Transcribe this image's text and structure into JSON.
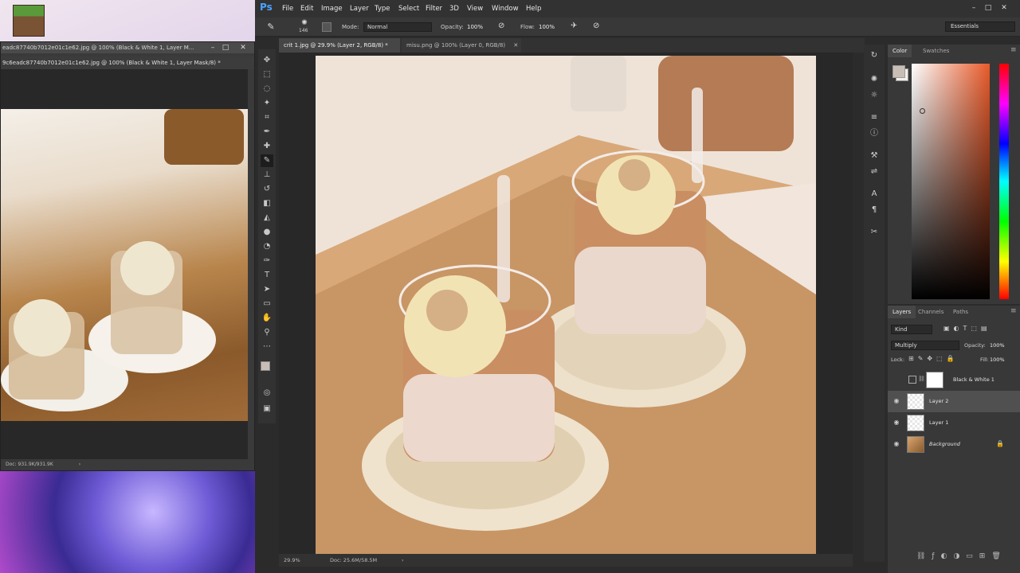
{
  "desktop": {
    "icon_name": "minecraft-icon"
  },
  "float_window": {
    "title": "eadc87740b7012e01c1e62.jpg @ 100% (Black & White 1, Layer M...",
    "tab": "9c6eadc87740b7012e01c1e62.jpg @ 100% (Black & White 1, Layer Mask/8) *",
    "status": "Doc: 931.9K/931.9K"
  },
  "ps": {
    "logo": "Ps",
    "menu": [
      "File",
      "Edit",
      "Image",
      "Layer",
      "Type",
      "Select",
      "Filter",
      "3D",
      "View",
      "Window",
      "Help"
    ],
    "options": {
      "brush_size": "146",
      "mode_label": "Mode:",
      "mode_value": "Normal",
      "opacity_label": "Opacity:",
      "opacity_value": "100%",
      "flow_label": "Flow:",
      "flow_value": "100%",
      "workspace": "Essentials"
    },
    "doc_tabs": [
      {
        "label": "crit 1.jpg @ 29.9% (Layer 2, RGB/8) *",
        "active": true
      },
      {
        "label": "misu.png @ 100% (Layer 0, RGB/8)",
        "active": false
      }
    ],
    "status": {
      "zoom": "29.9%",
      "doc": "Doc: 25.6M/58.5M"
    },
    "color_panel": {
      "tabs": [
        "Color",
        "Swatches"
      ],
      "foreground": "#c9beb6",
      "background": "#f4efea"
    },
    "layers_panel": {
      "tabs": [
        "Layers",
        "Channels",
        "Paths"
      ],
      "kind": "Kind",
      "blend_mode": "Multiply",
      "opacity_label": "Opacity:",
      "opacity_value": "100%",
      "lock_label": "Lock:",
      "fill_label": "Fill:",
      "fill_value": "100%",
      "layers": [
        {
          "name": "Black & White 1",
          "visible": false,
          "selected": false
        },
        {
          "name": "Layer 2",
          "visible": true,
          "selected": true
        },
        {
          "name": "Layer 1",
          "visible": true,
          "selected": false
        },
        {
          "name": "Background",
          "visible": true,
          "selected": false
        }
      ]
    }
  }
}
